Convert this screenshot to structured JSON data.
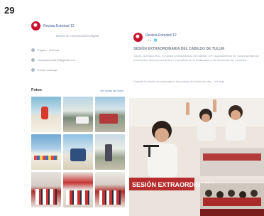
{
  "page_number": "29",
  "left_card": {
    "page_name": "Revista Entedad 12",
    "subline": "Medio de comunicación digital",
    "info_rows": [
      "Página · Noticias",
      "revistaentedad12@gmail.com",
      "Enviar mensaje"
    ],
    "photos_title": "Fotos",
    "see_all_label": "Ver todas las fotos"
  },
  "post": {
    "page_name": "Revista Entedad 12",
    "timestamp": "· 3 h · 🌐",
    "title": "SESIÓN EXTRAORDINARIA DEL CABILDO DE TULUM",
    "paragraphs": [
      "Tulum, Quintana Roo. En sesión extraordinaria de Cabildo, el H. Ayuntamiento de Tulum aprobó por unanimidad diversos acuerdos en beneficio de la ciudadanía y del desarrollo del municipio.",
      "Durante la sesión se presentaron los puntos del orden del día... Ver más"
    ],
    "photo_banner_text": "SESIÓN EXTRAORDINARIA"
  },
  "colors": {
    "brand_red": "#c8102e",
    "link_blue": "#3b5998"
  }
}
